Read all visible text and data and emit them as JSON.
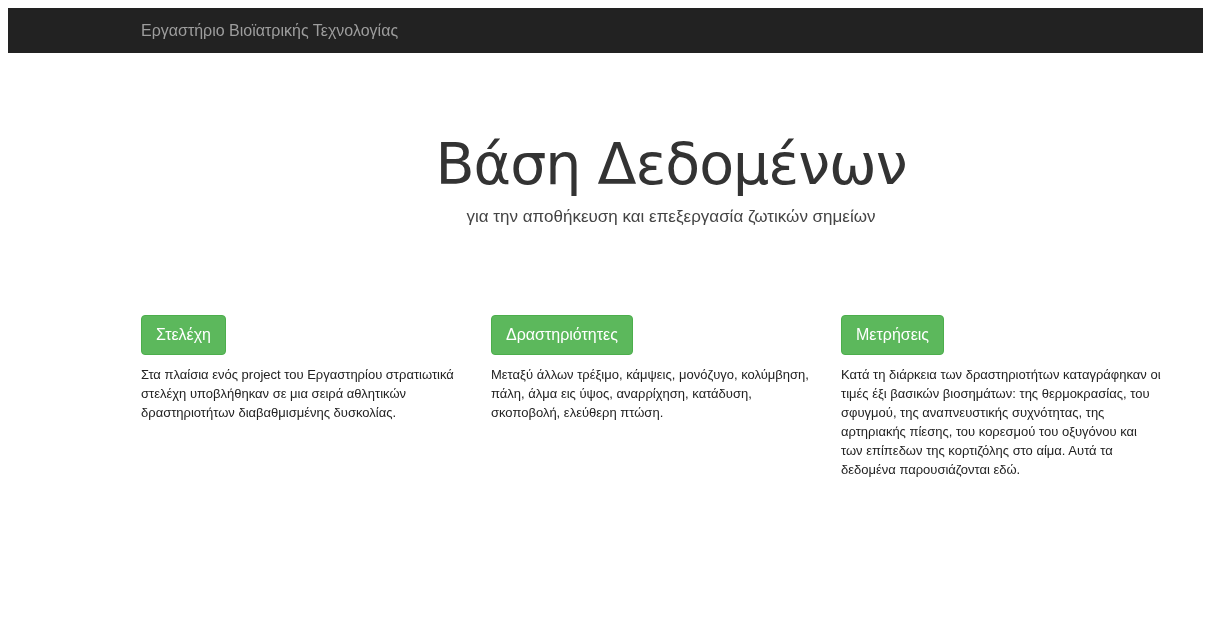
{
  "navbar": {
    "brand": "Εργαστήριο Βιοϊατρικής Τεχνολογίας"
  },
  "hero": {
    "title": "Βάση Δεδομένων",
    "subtitle": "για την αποθήκευση και επεξεργασία ζωτικών σημείων"
  },
  "sections": [
    {
      "button": "Στελέχη",
      "text": "Στα πλαίσια ενός project του Εργαστηρίου στρατιωτικά στελέχη υποβλήθηκαν σε μια σειρά αθλητικών δραστηριοτήτων διαβαθμισμένης δυσκολίας."
    },
    {
      "button": "Δραστηριότητες",
      "text": "Μεταξύ άλλων τρέξιμο, κάμψεις, μονόζυγο, κολύμβηση, πάλη, άλμα εις ύψος, αναρρίχηση, κατάδυση, σκοποβολή, ελεύθερη πτώση."
    },
    {
      "button": "Μετρήσεις",
      "text": "Κατά τη διάρκεια των δραστηριοτήτων καταγράφηκαν οι τιμές έξι βασικών βιοσημάτων: της θερμοκρασίας, του σφυγμού, της αναπνευστικής συχνότητας, της αρτηριακής πίεσης, του κορεσμού του οξυγόνου και των επίπεδων της κορτιζόλης στο αίμα. Αυτά τα δεδομένα παρουσιάζονται εδώ."
    }
  ]
}
